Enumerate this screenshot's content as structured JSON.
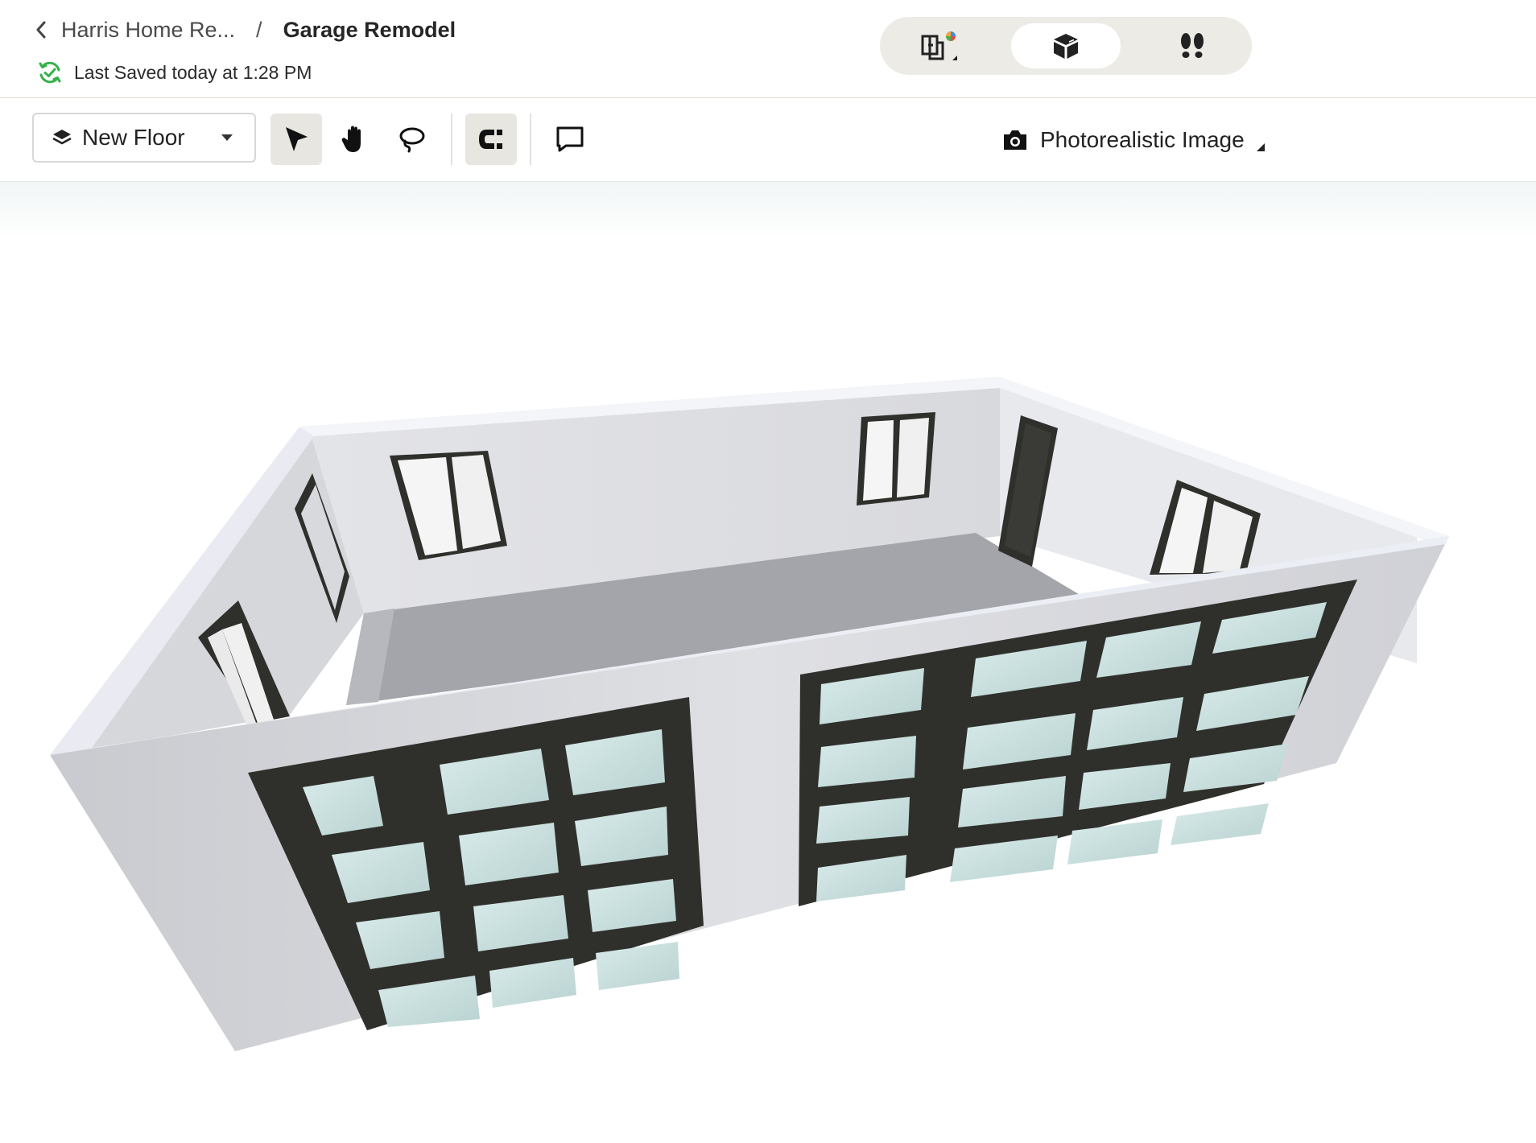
{
  "header": {
    "back_icon": "chevron-left-icon",
    "breadcrumb_parent": "Harris Home Re...",
    "breadcrumb_separator": "/",
    "breadcrumb_current": "Garage Remodel",
    "save_status": "Last Saved today at 1:28 PM",
    "save_status_color": "#35b24a"
  },
  "view_switch": {
    "options": [
      {
        "icon": "floorplan-2d-icon",
        "active": false
      },
      {
        "icon": "3d-box-icon",
        "active": true
      },
      {
        "icon": "walkthrough-footprints-icon",
        "active": false
      }
    ]
  },
  "toolbar": {
    "floor_select": {
      "icon": "layers-icon",
      "value": "New Floor"
    },
    "tools": [
      {
        "icon": "select-arrow-icon",
        "active": true
      },
      {
        "icon": "pan-hand-icon",
        "active": false
      },
      {
        "icon": "lasso-icon",
        "active": false
      },
      {
        "icon": "magnet-snap-icon",
        "active": true
      },
      {
        "icon": "comment-icon",
        "active": false
      }
    ],
    "render_button": {
      "icon": "camera-icon",
      "label": "Photorealistic Image"
    }
  },
  "scene": {
    "description_icon": "3d-garage-model",
    "wall_color": "#dcdde1",
    "floor_color": "#a5a7ad",
    "frame_color": "#2f302c",
    "glass_color": "#c5dcdb"
  }
}
